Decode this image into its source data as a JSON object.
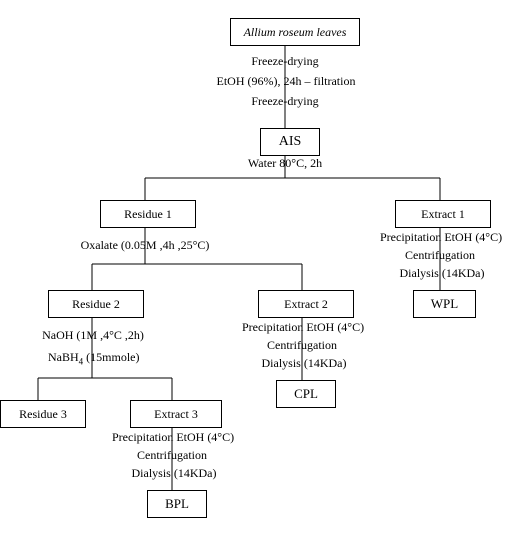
{
  "diagram": {
    "title_box": "Allium roseum leaves",
    "step_top_1": "Freeze-drying",
    "step_top_2": "EtOH (96%), 24h – filtration",
    "step_top_3": "Freeze-drying",
    "ais_box": "AIS",
    "step_ais": "Water 80°C, 2h",
    "residue1_box": "Residue 1",
    "extract1_box": "Extract 1",
    "extract1_step1": "Precipitation EtOH (4°C)",
    "extract1_step2": "Centrifugation",
    "extract1_step3": "Dialysis (14KDa)",
    "wpl_box": "WPL",
    "residue1_step": "Oxalate (0.05M ,4h ,25°C)",
    "residue2_box": "Residue 2",
    "extract2_box": "Extract 2",
    "extract2_step1": "Precipitation EtOH (4°C)",
    "extract2_step2": "Centrifugation",
    "extract2_step3": "Dialysis (14KDa)",
    "cpl_box": "CPL",
    "residue2_step1": "NaOH (1M ,4°C ,2h)",
    "residue2_step2_pre": "NaBH",
    "residue2_step2_sub": "4",
    "residue2_step2_post": " (15mmole)",
    "residue3_box": "Residue 3",
    "extract3_box": "Extract 3",
    "extract3_step1": "Precipitation EtOH (4°C)",
    "extract3_step2": "Centrifugation",
    "extract3_step3": "Dialysis (14KDa)",
    "bpl_box": "BPL"
  },
  "chart_data": {
    "type": "flowchart",
    "nodes": [
      {
        "id": "start",
        "label": "Allium roseum leaves",
        "type": "box"
      },
      {
        "id": "ais",
        "label": "AIS",
        "type": "box"
      },
      {
        "id": "res1",
        "label": "Residue 1",
        "type": "box"
      },
      {
        "id": "ext1",
        "label": "Extract 1",
        "type": "box"
      },
      {
        "id": "wpl",
        "label": "WPL",
        "type": "box"
      },
      {
        "id": "res2",
        "label": "Residue 2",
        "type": "box"
      },
      {
        "id": "ext2",
        "label": "Extract 2",
        "type": "box"
      },
      {
        "id": "cpl",
        "label": "CPL",
        "type": "box"
      },
      {
        "id": "res3",
        "label": "Residue 3",
        "type": "box"
      },
      {
        "id": "ext3",
        "label": "Extract 3",
        "type": "box"
      },
      {
        "id": "bpl",
        "label": "BPL",
        "type": "box"
      }
    ],
    "edges": [
      {
        "from": "start",
        "to": "ais",
        "labels": [
          "Freeze-drying",
          "EtOH (96%), 24h – filtration",
          "Freeze-drying"
        ]
      },
      {
        "from": "ais",
        "to": "res1",
        "labels": [
          "Water 80°C, 2h"
        ]
      },
      {
        "from": "ais",
        "to": "ext1",
        "labels": [
          "Water 80°C, 2h"
        ]
      },
      {
        "from": "ext1",
        "to": "wpl",
        "labels": [
          "Precipitation EtOH (4°C)",
          "Centrifugation",
          "Dialysis (14KDa)"
        ]
      },
      {
        "from": "res1",
        "to": "res2",
        "labels": [
          "Oxalate (0.05M ,4h ,25°C)"
        ]
      },
      {
        "from": "res1",
        "to": "ext2",
        "labels": [
          "Oxalate (0.05M ,4h ,25°C)"
        ]
      },
      {
        "from": "ext2",
        "to": "cpl",
        "labels": [
          "Precipitation EtOH (4°C)",
          "Centrifugation",
          "Dialysis (14KDa)"
        ]
      },
      {
        "from": "res2",
        "to": "res3",
        "labels": [
          "NaOH (1M ,4°C ,2h)",
          "NaBH4 (15mmole)"
        ]
      },
      {
        "from": "res2",
        "to": "ext3",
        "labels": [
          "NaOH (1M ,4°C ,2h)",
          "NaBH4 (15mmole)"
        ]
      },
      {
        "from": "ext3",
        "to": "bpl",
        "labels": [
          "Precipitation EtOH (4°C)",
          "Centrifugation",
          "Dialysis (14KDa)"
        ]
      }
    ]
  }
}
